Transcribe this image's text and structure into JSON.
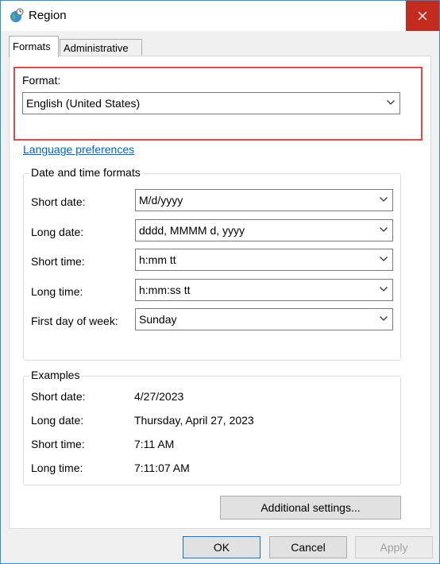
{
  "window": {
    "title": "Region",
    "close_symbol": "✕"
  },
  "tabs": [
    {
      "label": "Formats",
      "active": true
    },
    {
      "label": "Administrative",
      "active": false
    }
  ],
  "format": {
    "label": "Format:",
    "value": "English (United States)"
  },
  "language_preferences_link": "Language preferences",
  "date_time_formats": {
    "title": "Date and time formats",
    "rows": [
      {
        "label": "Short date:",
        "value": "M/d/yyyy"
      },
      {
        "label": "Long date:",
        "value": "dddd, MMMM d, yyyy"
      },
      {
        "label": "Short time:",
        "value": "h:mm tt"
      },
      {
        "label": "Long time:",
        "value": "h:mm:ss tt"
      },
      {
        "label": "First day of week:",
        "value": "Sunday"
      }
    ]
  },
  "examples": {
    "title": "Examples",
    "rows": [
      {
        "label": "Short date:",
        "value": "4/27/2023"
      },
      {
        "label": "Long date:",
        "value": "Thursday, April 27, 2023"
      },
      {
        "label": "Short time:",
        "value": "7:11 AM"
      },
      {
        "label": "Long time:",
        "value": "7:11:07 AM"
      }
    ]
  },
  "buttons": {
    "additional_settings": "Additional settings...",
    "ok": "OK",
    "cancel": "Cancel",
    "apply": "Apply"
  },
  "icons": {
    "app": "globe-clock-icon",
    "dropdown": "chevron-down-icon",
    "close": "close-icon"
  },
  "colors": {
    "highlight": "#e04a4a",
    "link": "#0066cc",
    "close_button": "#c42b1c",
    "default_button_border": "#0078d7"
  }
}
